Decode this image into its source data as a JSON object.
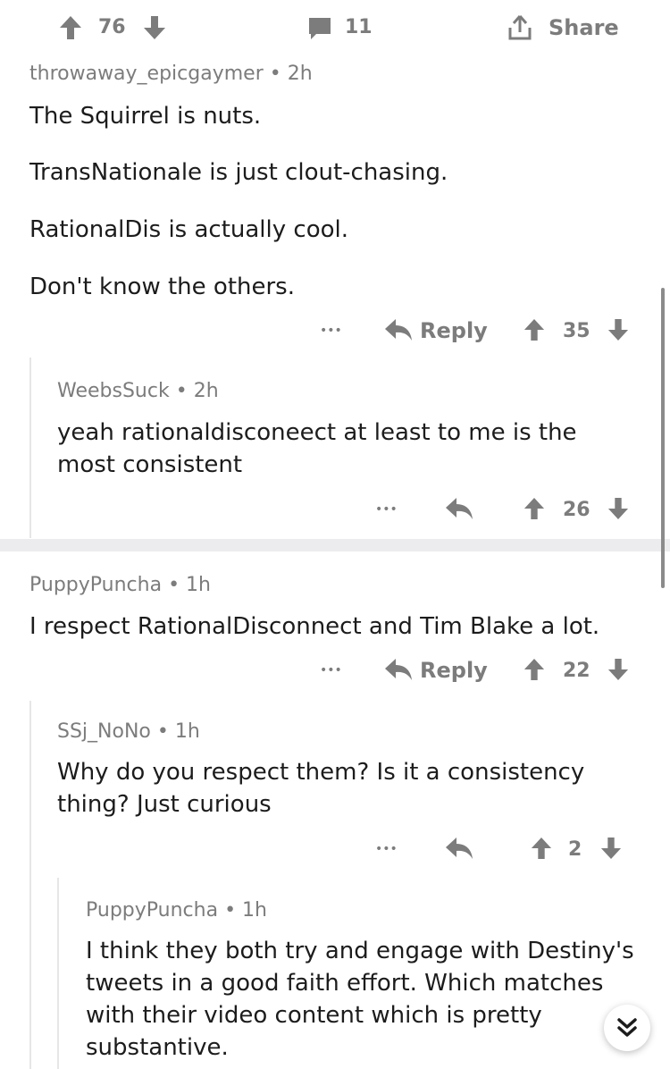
{
  "post_bar": {
    "upvotes": "76",
    "comments": "11",
    "share_label": "Share"
  },
  "comments": [
    {
      "author": "throwaway_epicgaymer",
      "time": "2h",
      "paragraphs": [
        "The Squirrel is nuts.",
        "TransNationale is just clout-chasing.",
        "RationalDis is actually cool.",
        "Don't know the others."
      ],
      "more": "•••",
      "reply_label": "Reply",
      "score": "35"
    },
    {
      "author": "WeebsSuck",
      "time": "2h",
      "text": "yeah rationaldisconeect at least to me is the most consistent",
      "more": "•••",
      "score": "26"
    },
    {
      "author": "PuppyPuncha",
      "time": "1h",
      "text": "I respect RationalDisconnect and Tim Blake a lot.",
      "more": "•••",
      "reply_label": "Reply",
      "score": "22"
    },
    {
      "author": "SSj_NoNo",
      "time": "1h",
      "text": "Why do you respect them? Is it a consistency thing? Just curious",
      "more": "•••",
      "score": "2"
    },
    {
      "author": "PuppyPuncha",
      "time": "1h",
      "text": "I think they both try and engage with Destiny's tweets in a good faith effort. Which matches with their video content which is pretty substantive."
    }
  ],
  "separator": "•",
  "icons": {
    "upvote": "up-arrow-icon",
    "downvote": "down-arrow-icon",
    "comment": "comment-bubble-icon",
    "share": "share-icon",
    "reply": "reply-arrow-icon",
    "scroll": "double-chevron-down-icon"
  },
  "colors": {
    "text": "#1c1c1c",
    "meta": "#7c7c7c",
    "divider": "#ececef",
    "thread_line": "#e6e6e6"
  }
}
